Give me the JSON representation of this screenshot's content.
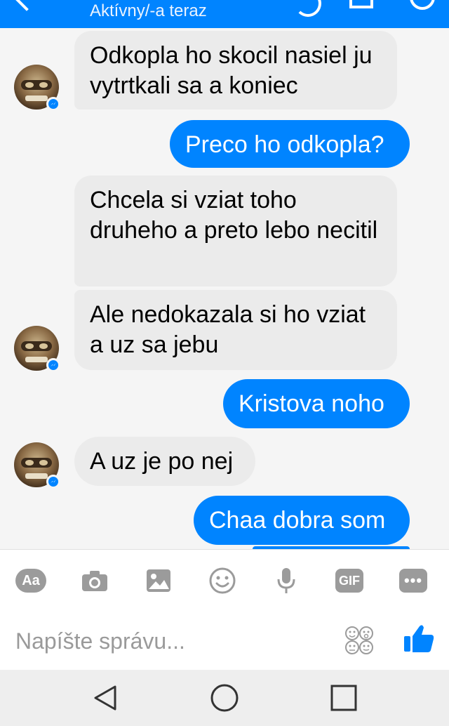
{
  "header": {
    "status": "Aktívny/-a teraz"
  },
  "messages": [
    {
      "side": "in",
      "text": "Odkopla ho skocil nasiel ju vytrtkali sa a koniec"
    },
    {
      "side": "out",
      "text": "Preco ho odkopla?"
    },
    {
      "side": "in",
      "text": "Chcela si vziat toho druheho a preto lebo necitil"
    },
    {
      "side": "in",
      "text": "Ale nedokazala si ho vziat a uz sa jebu"
    },
    {
      "side": "out",
      "text": "Kristova noho"
    },
    {
      "side": "in",
      "text": "A uz je po nej"
    },
    {
      "side": "out",
      "text": "Chaa dobra som"
    }
  ],
  "toolbar": {
    "aa_label": "Aa",
    "gif_label": "GIF",
    "more_label": "•••",
    "icons": [
      "aa-icon",
      "camera-icon",
      "image-icon",
      "emoji-icon",
      "microphone-icon",
      "gif-icon",
      "more-icon"
    ]
  },
  "composer": {
    "placeholder": "Napíšte správu..."
  },
  "colors": {
    "accent": "#0084ff",
    "incoming_bubble": "#ebebeb",
    "icon_gray": "#9b9b9b"
  }
}
